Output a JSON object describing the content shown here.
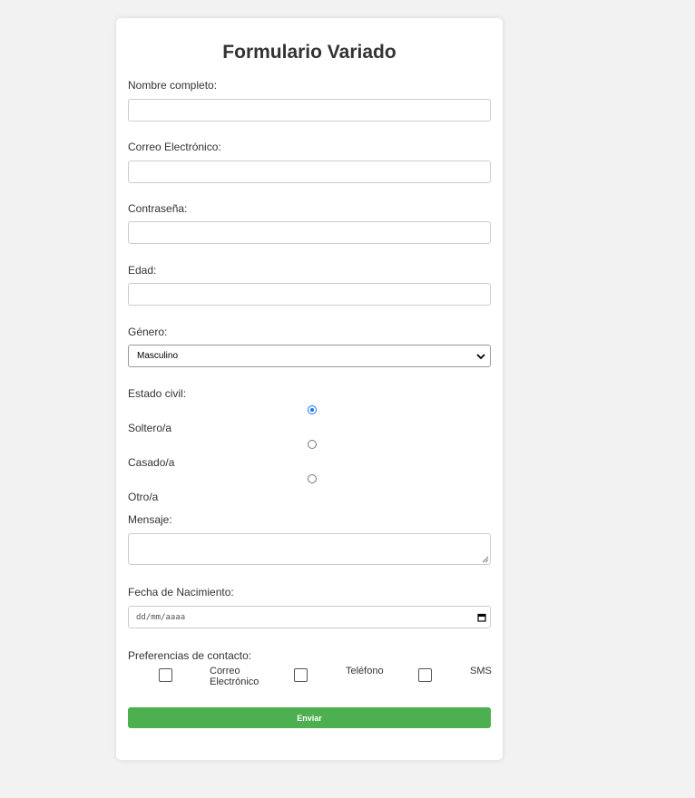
{
  "form": {
    "title": "Formulario Variado",
    "name_label": "Nombre completo:",
    "name_value": "",
    "email_label": "Correo Electrónico:",
    "email_value": "",
    "password_label": "Contraseña:",
    "password_value": "",
    "age_label": "Edad:",
    "age_value": "",
    "gender_label": "Género:",
    "gender_selected": "Masculino",
    "marital_label": "Estado civil:",
    "marital_options": [
      {
        "label": "Soltero/a",
        "checked": true
      },
      {
        "label": "Casado/a",
        "checked": false
      },
      {
        "label": "Otro/a",
        "checked": false
      }
    ],
    "message_label": "Mensaje:",
    "message_value": "",
    "birthdate_label": "Fecha de Nacimiento:",
    "birthdate_placeholder": "dd/mm/aaaa",
    "contact_label": "Preferencias de contacto:",
    "contact_options": [
      {
        "label": "Correo Electrónico",
        "checked": false
      },
      {
        "label": "Teléfono",
        "checked": false
      },
      {
        "label": "SMS",
        "checked": false
      }
    ],
    "submit_label": "Enviar"
  },
  "colors": {
    "background": "#f2f2f2",
    "card": "#ffffff",
    "accent": "#4caf50",
    "radio_selected": "#1a73e8"
  },
  "icons": {
    "select": "chevron-down-icon",
    "date": "calendar-icon",
    "textarea": "resize-grip-icon"
  }
}
